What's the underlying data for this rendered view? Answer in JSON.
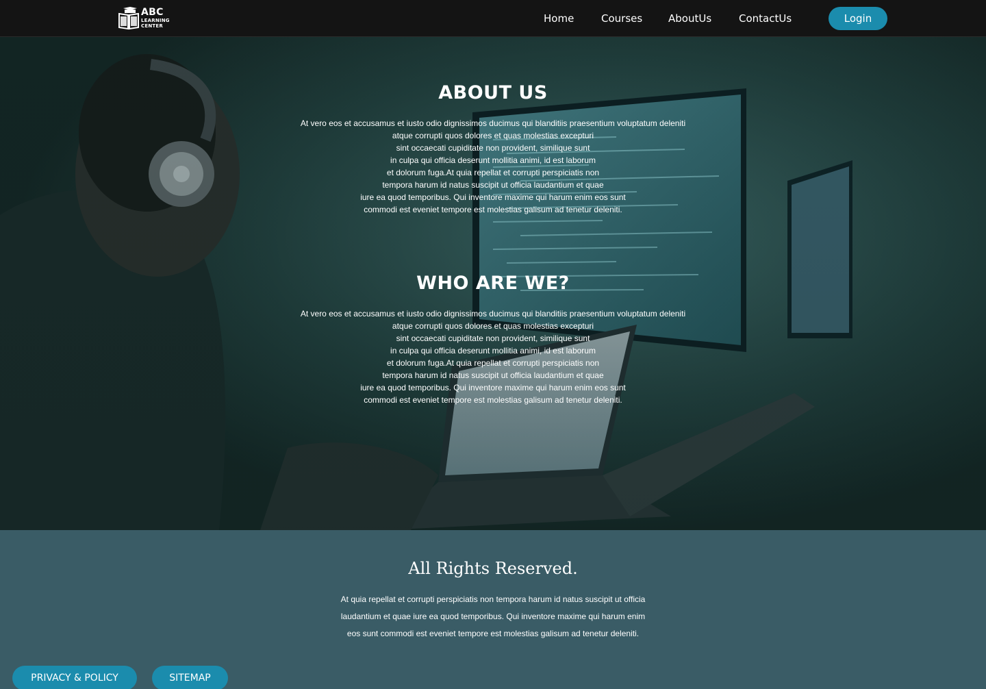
{
  "brand": {
    "name": "ABC",
    "sub_line1": "LEARNING",
    "sub_line2": "CENTER"
  },
  "nav": {
    "items": [
      "Home",
      "Courses",
      "AboutUs",
      "ContactUs"
    ],
    "login": "Login"
  },
  "about": {
    "title": "ABOUT US",
    "lines": [
      "At vero eos et accusamus et iusto odio dignissimos ducimus qui blanditiis praesentium voluptatum deleniti",
      "atque corrupti quos dolores et quas molestias excepturi",
      "sint occaecati cupiditate non provident, similique sunt",
      "in culpa qui officia deserunt mollitia animi, id est laborum",
      "et dolorum fuga.At quia repellat et corrupti perspiciatis non",
      "tempora harum id natus suscipit ut officia laudantium et quae",
      "iure ea quod temporibus. Qui inventore maxime qui harum enim eos sunt",
      "commodi est eveniet tempore est molestias galisum ad tenetur deleniti."
    ]
  },
  "who": {
    "title": "WHO ARE WE?",
    "lines": [
      "At vero eos et accusamus et iusto odio dignissimos ducimus qui blanditiis praesentium voluptatum deleniti",
      "atque corrupti quos dolores et quas molestias excepturi",
      "sint occaecati cupiditate non provident, similique sunt",
      "in culpa qui officia deserunt mollitia animi, id est laborum",
      "et dolorum fuga.At quia repellat et corrupti perspiciatis non",
      "tempora harum id natus suscipit ut officia laudantium et quae",
      "iure ea quod temporibus. Qui inventore maxime qui harum enim eos sunt",
      "commodi est eveniet tempore est molestias galisum ad tenetur deleniti."
    ]
  },
  "footer": {
    "title": "All Rights Reserved.",
    "text": "At quia repellat et corrupti perspiciatis non tempora harum id natus suscipit ut officia laudantium et quae iure ea quod temporibus. Qui inventore maxime qui harum enim eos sunt commodi est eveniet tempore est molestias galisum ad tenetur deleniti.",
    "privacy": "PRIVACY & POLICY",
    "sitemap": "SITEMAP"
  },
  "colors": {
    "nav_bg": "#141414",
    "accent": "#1b8cad",
    "footer_bg": "#3a5c66"
  }
}
